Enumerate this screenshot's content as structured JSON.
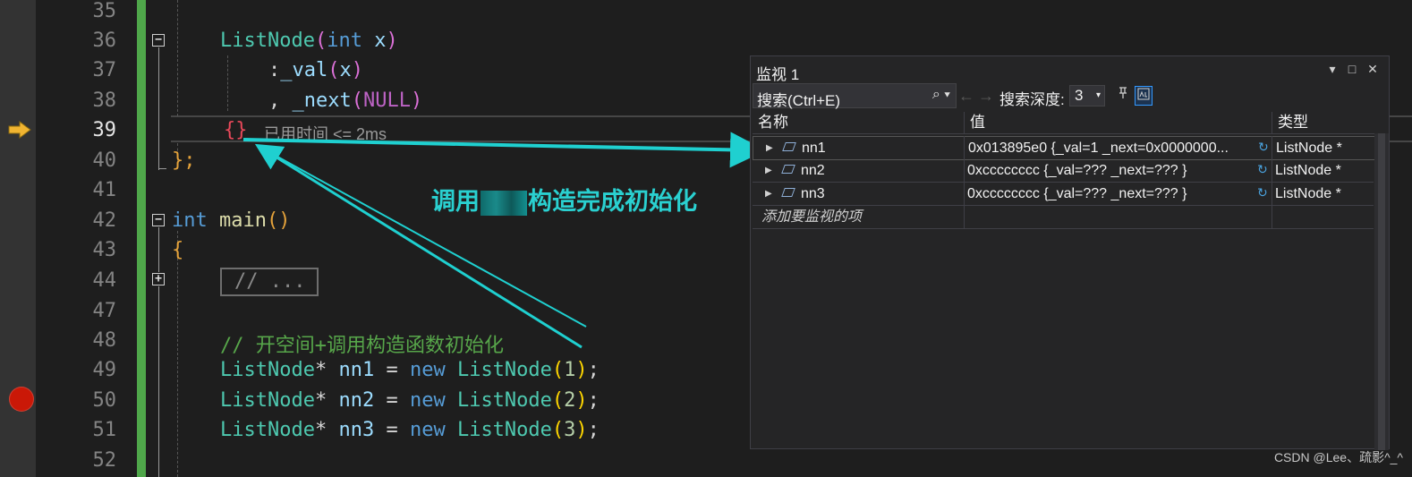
{
  "editor": {
    "line_numbers": [
      "35",
      "36",
      "37",
      "38",
      "39",
      "40",
      "41",
      "42",
      "43",
      "44",
      "47",
      "48",
      "49",
      "50",
      "51",
      "52"
    ],
    "current_line": "39",
    "lines": {
      "l36": {
        "type": "ListNode",
        "paren_open": "(",
        "kw": "int",
        "var": " x",
        "paren_close": ")"
      },
      "l37": {
        "colon": ":",
        "member": "_val",
        "paren_open": "(",
        "arg": "x",
        "paren_close": ")"
      },
      "l38": {
        "comma": ", ",
        "member": "_next",
        "paren_open": "(",
        "arg": "NULL",
        "paren_close": ")"
      },
      "l39": {
        "braces": "{}"
      },
      "l40": {
        "close": "};"
      },
      "l42": {
        "kw": "int",
        "fn": " main",
        "parens": "()"
      },
      "l43": {
        "brace": "{"
      },
      "l44": {
        "collapsed": "// ..."
      },
      "l48": {
        "comment": "// 开空间+调用构造函数初始化"
      },
      "l49": {
        "type": "ListNode",
        "star": "*",
        "var": " nn1",
        "eq": " = ",
        "kw": "new",
        "ctor": " ListNode",
        "p1": "(",
        "num": "1",
        "p2": ")",
        "semi": ";"
      },
      "l50": {
        "type": "ListNode",
        "star": "*",
        "var": " nn2",
        "eq": " = ",
        "kw": "new",
        "ctor": " ListNode",
        "p1": "(",
        "num": "2",
        "p2": ")",
        "semi": ";"
      },
      "l51": {
        "type": "ListNode",
        "star": "*",
        "var": " nn3",
        "eq": " = ",
        "kw": "new",
        "ctor": " ListNode",
        "p1": "(",
        "num": "3",
        "p2": ")",
        "semi": ";"
      }
    },
    "elapsed_label": "已用时间",
    "elapsed_value": " <= 2ms",
    "fold_minus": "−",
    "fold_plus": "+"
  },
  "annotation": {
    "text_before": "调用",
    "text_after": "构造完成初始化",
    "color": "#2ad0d0"
  },
  "watch": {
    "title": "监视 1",
    "window_buttons": {
      "dropdown": "▾",
      "maximize": "□",
      "close": "✕"
    },
    "search_placeholder": "搜索(Ctrl+E)",
    "search_icon": "⌕ ▾",
    "back_arrow": "←",
    "forward_arrow": "→",
    "depth_label": "搜索深度:",
    "depth_value": "3",
    "depth_caret": "▾",
    "columns": {
      "name": "名称",
      "value": "值",
      "type": "类型"
    },
    "rows": [
      {
        "name": "nn1",
        "value": "0x013895e0 {_val=1 _next=0x0000000...",
        "type": "ListNode *"
      },
      {
        "name": "nn2",
        "value": "0xcccccccc {_val=??? _next=??? }",
        "type": "ListNode *"
      },
      {
        "name": "nn3",
        "value": "0xcccccccc {_val=??? _next=??? }",
        "type": "ListNode *"
      }
    ],
    "add_item": "添加要监视的项",
    "expander_glyph": "▶",
    "refresh_glyph": "↻"
  },
  "watermark": "CSDN @Lee、疏影^_^",
  "colors": {
    "background": "#1e1e1e",
    "type": "#4ec9b0",
    "keyword": "#569cd6",
    "comment": "#57a64a",
    "breakpoint": "#e51400",
    "change_bar": "#4fa74a"
  }
}
